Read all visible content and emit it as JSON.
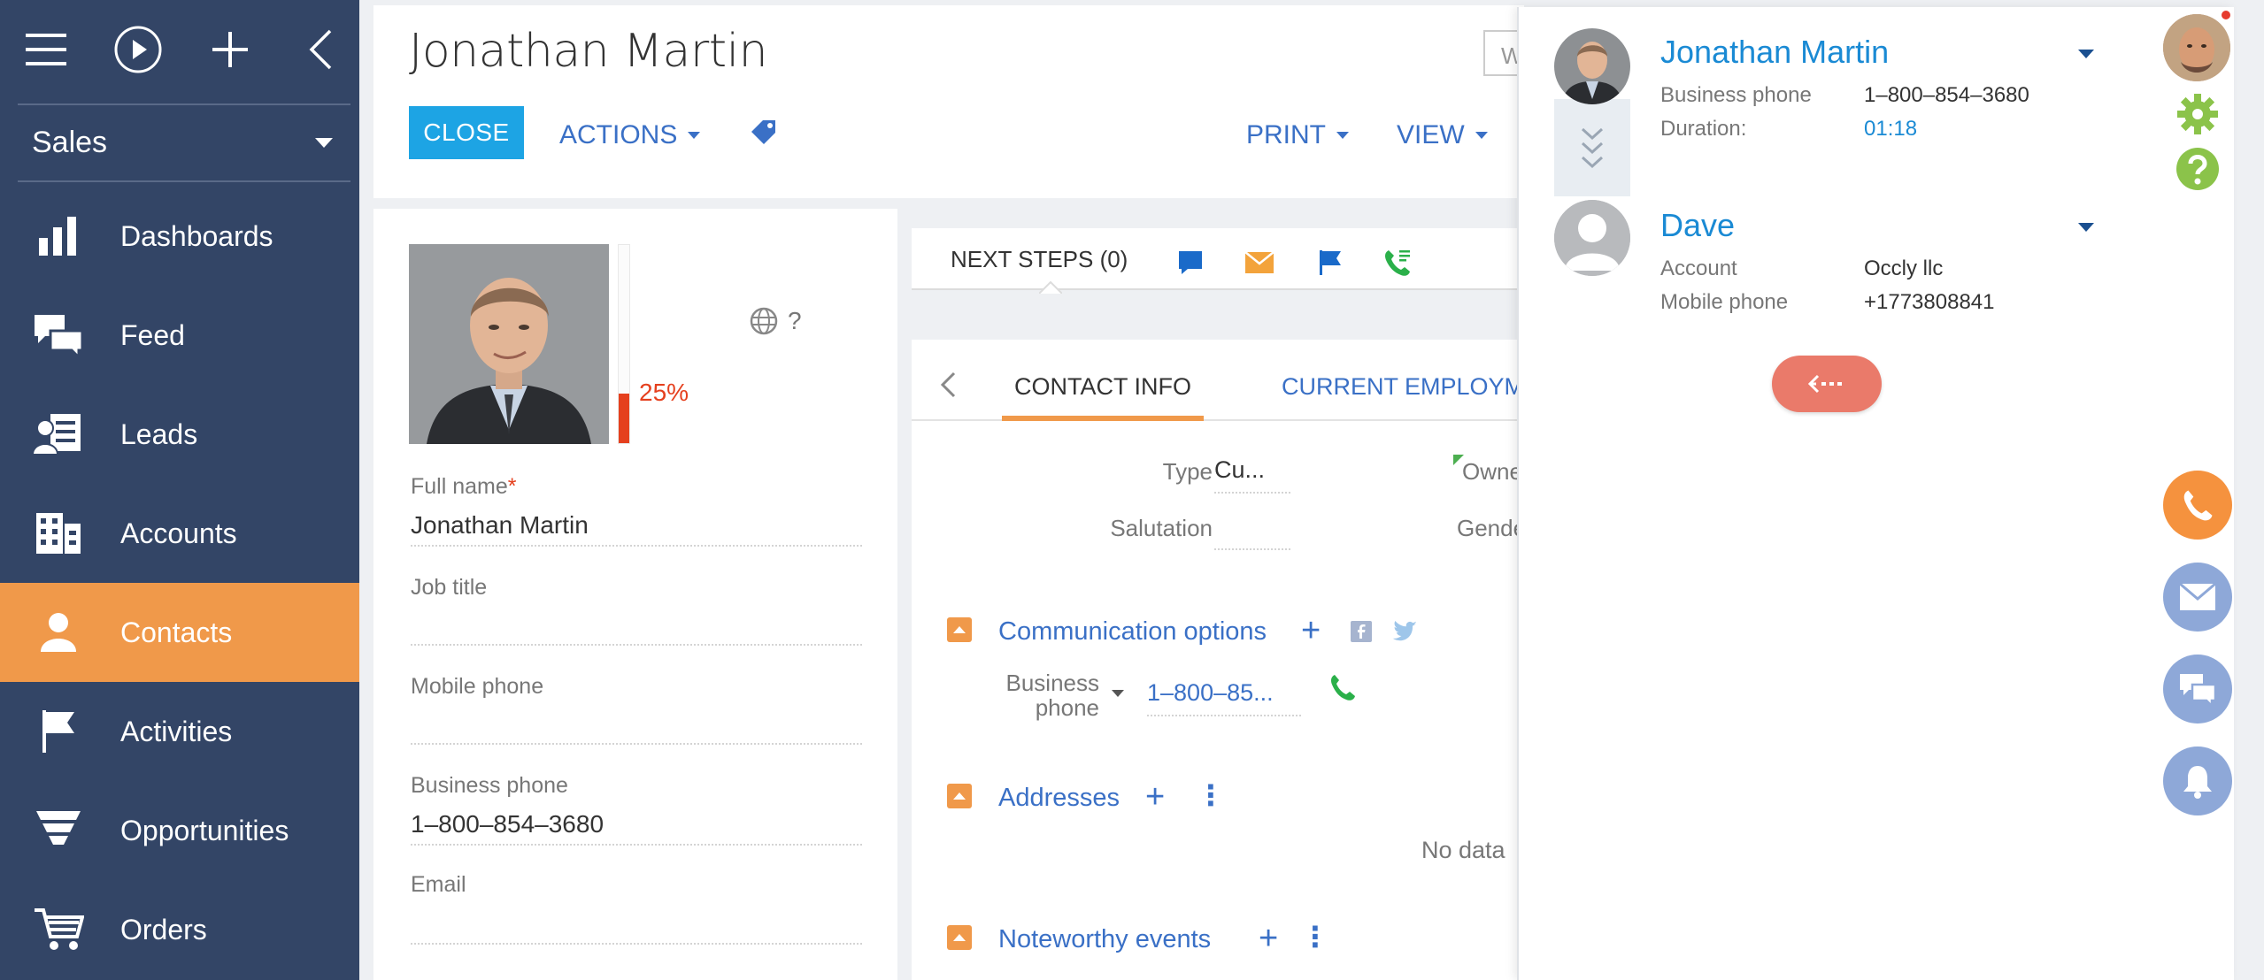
{
  "sidebar": {
    "section": "Sales",
    "items": [
      {
        "label": "Dashboards",
        "icon": "bar-chart-icon"
      },
      {
        "label": "Feed",
        "icon": "chat-bubbles-icon"
      },
      {
        "label": "Leads",
        "icon": "leads-icon"
      },
      {
        "label": "Accounts",
        "icon": "building-icon"
      },
      {
        "label": "Contacts",
        "icon": "person-icon"
      },
      {
        "label": "Activities",
        "icon": "flag-icon"
      },
      {
        "label": "Opportunities",
        "icon": "funnel-icon"
      },
      {
        "label": "Orders",
        "icon": "cart-icon"
      }
    ],
    "active": "Contacts"
  },
  "header": {
    "title": "Jonathan Martin",
    "close_label": "CLOSE",
    "actions_label": "ACTIONS",
    "print_label": "PRINT",
    "view_label": "VIEW",
    "search_fragment": "W"
  },
  "profile": {
    "completeness": 25,
    "completeness_label": "25%",
    "globe_text": "?",
    "fields": [
      {
        "label": "Full name",
        "required": "*",
        "value": "Jonathan Martin"
      },
      {
        "label": "Job title",
        "value": ""
      },
      {
        "label": "Mobile phone",
        "value": ""
      },
      {
        "label": "Business phone",
        "value": "1–800–854–3680"
      },
      {
        "label": "Email",
        "value": ""
      }
    ]
  },
  "next_steps": {
    "title": "NEXT STEPS (0)"
  },
  "tabs": {
    "items": [
      "CONTACT INFO",
      "CURRENT EMPLOYMENT"
    ],
    "active": "CONTACT INFO"
  },
  "contact_info": {
    "type_label": "Type",
    "type_value": "Cu...",
    "salutation_label": "Salutation",
    "salutation_value": "",
    "owner_label": "Owne",
    "gender_label": "Gende",
    "sections": {
      "communication": "Communication options",
      "addresses": "Addresses",
      "noteworthy": "Noteworthy events"
    },
    "business_phone_label": "Business phone",
    "business_phone_line1": "Business",
    "business_phone_line2": "phone",
    "business_phone_value": "1–800–85...",
    "no_data": "No data"
  },
  "cti": {
    "caller": {
      "name": "Jonathan Martin",
      "phone_label": "Business phone",
      "phone_value": "1–800–854–3680",
      "duration_label": "Duration:",
      "duration_value": "01:18"
    },
    "callee": {
      "name": "Dave",
      "account_label": "Account",
      "account_value": "Occly llc",
      "mobile_label": "Mobile phone",
      "mobile_value": "+1773808841"
    }
  },
  "colors": {
    "sidebar": "#334566",
    "accent": "#f0994a",
    "link": "#3a70c6",
    "close_button": "#1da4e4",
    "progress": "#e5401e"
  }
}
